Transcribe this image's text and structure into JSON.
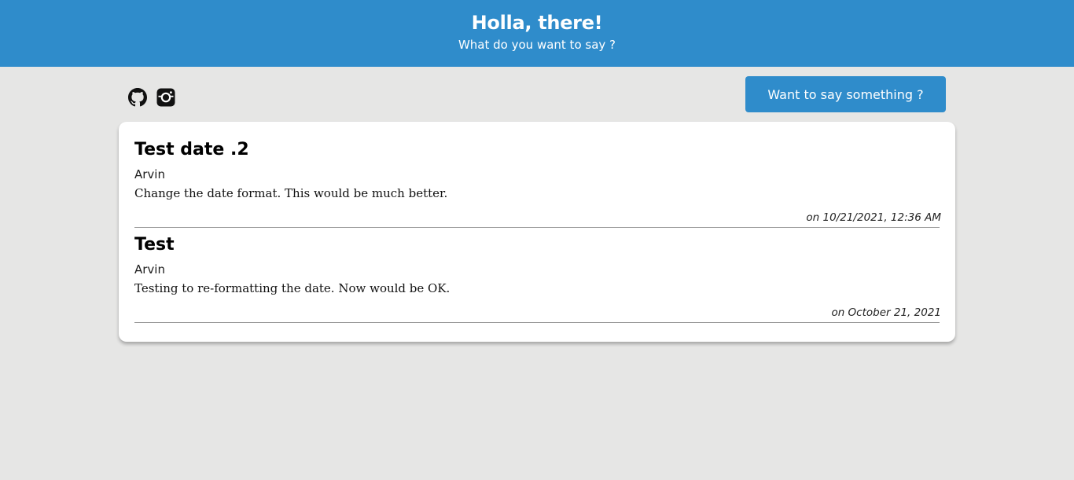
{
  "header": {
    "title": "Holla, there!",
    "subtitle": "What do you want to say ?"
  },
  "toolbar": {
    "social_icons": [
      "github-icon",
      "instagram-icon"
    ],
    "action_button_label": "Want to say something ?"
  },
  "posts": [
    {
      "title": "Test date .2",
      "author": "Arvin",
      "message": "Change the date format. This would be much better.",
      "date": "on 10/21/2021, 12:36 AM"
    },
    {
      "title": "Test",
      "author": "Arvin",
      "message": "Testing to re-formatting the date. Now would be OK.",
      "date": "on October 21, 2021"
    }
  ],
  "colors": {
    "accent": "#2f8ccb",
    "page_background": "#e6e6e5",
    "card_background": "#ffffff"
  }
}
